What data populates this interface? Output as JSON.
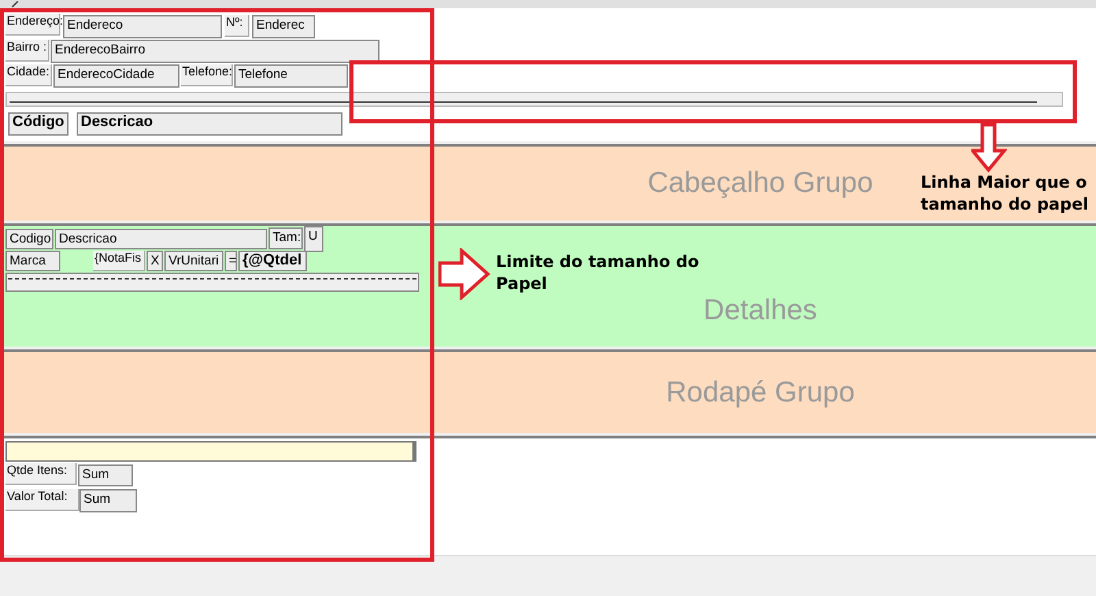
{
  "sections": [
    {
      "kind": "page_header",
      "fields": [
        {
          "kind": "label",
          "text": "Endereço:"
        },
        {
          "kind": "field",
          "text": "Endereco"
        },
        {
          "kind": "label",
          "text": "Nº:"
        },
        {
          "kind": "field",
          "text": "Enderec"
        },
        {
          "kind": "label",
          "text": "Bairro :"
        },
        {
          "kind": "field",
          "text": "EnderecoBairro"
        },
        {
          "kind": "label",
          "text": "Cidade:"
        },
        {
          "kind": "field",
          "text": "EnderecoCidade"
        },
        {
          "kind": "label",
          "text": "Telefone:"
        },
        {
          "kind": "field",
          "text": "Telefone"
        },
        {
          "kind": "line"
        },
        {
          "kind": "bold",
          "text": "Código"
        },
        {
          "kind": "bold",
          "text": "Descricao"
        }
      ]
    },
    {
      "kind": "group_header",
      "title": "Cabeçalho Grupo"
    },
    {
      "kind": "details",
      "title": "Detalhes",
      "fields": [
        {
          "kind": "field",
          "text": "Codigo"
        },
        {
          "kind": "field",
          "text": "Descricao"
        },
        {
          "kind": "field",
          "text": "Tam:"
        },
        {
          "kind": "field",
          "text": "U"
        },
        {
          "kind": "field",
          "text": "Marca"
        },
        {
          "kind": "label",
          "text": "{NotaFis"
        },
        {
          "kind": "field",
          "text": "X"
        },
        {
          "kind": "field",
          "text": "VrUnitari"
        },
        {
          "kind": "field",
          "text": "="
        },
        {
          "kind": "bold",
          "text": "{@Qtdel"
        },
        {
          "kind": "dashed_line"
        }
      ]
    },
    {
      "kind": "group_footer",
      "title": "Rodapé Grupo"
    },
    {
      "kind": "report_footer",
      "fields": [
        {
          "kind": "highlight_line"
        },
        {
          "kind": "label",
          "text": "Qtde Itens:"
        },
        {
          "kind": "field",
          "text": "Sum"
        },
        {
          "kind": "label",
          "text": "Valor Total:"
        },
        {
          "kind": "field",
          "text": "Sum"
        }
      ]
    }
  ],
  "annotations": [
    {
      "kind": "arrow_down",
      "text": "Linha Maior que o tamanho do papel"
    },
    {
      "kind": "arrow_right",
      "text": "Limite do tamanho do Papel"
    }
  ]
}
